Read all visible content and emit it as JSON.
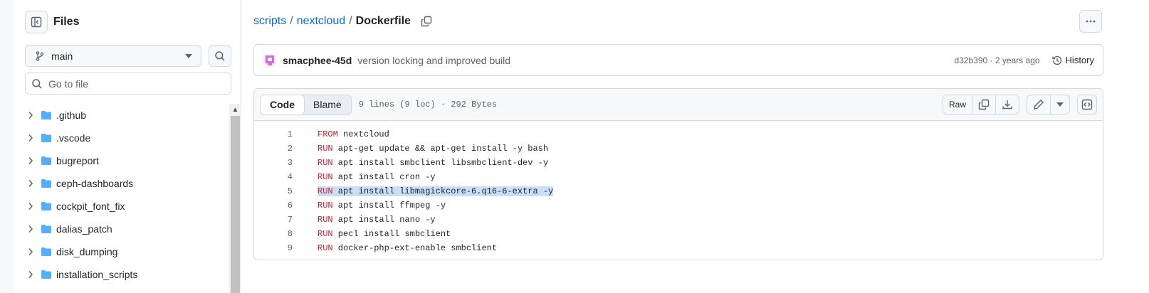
{
  "sidebar": {
    "title": "Files",
    "branch": "main",
    "search_placeholder": "Go to file",
    "items": [
      {
        "label": ".github"
      },
      {
        "label": ".vscode"
      },
      {
        "label": "bugreport"
      },
      {
        "label": "ceph-dashboards"
      },
      {
        "label": "cockpit_font_fix"
      },
      {
        "label": "dalias_patch"
      },
      {
        "label": "disk_dumping"
      },
      {
        "label": "installation_scripts"
      }
    ]
  },
  "breadcrumb": {
    "repo": "scripts",
    "sep1": "/",
    "folder": "nextcloud",
    "sep2": "/",
    "file": "Dockerfile"
  },
  "commit": {
    "author": "smacphee-45d",
    "message": "version locking and improved build",
    "meta": "d32b390 · 2 years ago",
    "history_label": "History"
  },
  "file": {
    "tab_code": "Code",
    "tab_blame": "Blame",
    "info": "9 lines (9 loc) · 292 Bytes",
    "raw_label": "Raw",
    "lines": [
      {
        "n": "1",
        "kw": "FROM",
        "rest": " nextcloud"
      },
      {
        "n": "2",
        "kw": "RUN",
        "rest": " apt-get update && apt-get install -y bash"
      },
      {
        "n": "3",
        "kw": "RUN",
        "rest": " apt install smbclient libsmbclient-dev -y"
      },
      {
        "n": "4",
        "kw": "RUN",
        "rest": " apt install cron -y"
      },
      {
        "n": "5",
        "kw": "RUN",
        "rest": " apt install libmagickcore-6.q16-6-extra -y"
      },
      {
        "n": "6",
        "kw": "RUN",
        "rest": " apt install ffmpeg -y"
      },
      {
        "n": "7",
        "kw": "RUN",
        "rest": " apt install nano -y"
      },
      {
        "n": "8",
        "kw": "RUN",
        "rest": " pecl install smbclient"
      },
      {
        "n": "9",
        "kw": "RUN",
        "rest": " docker-php-ext-enable smbclient"
      }
    ]
  },
  "colors": {
    "link": "#0969da",
    "keyword": "#cf222e",
    "folder": "#54aeff",
    "selection": "#c9def7"
  }
}
